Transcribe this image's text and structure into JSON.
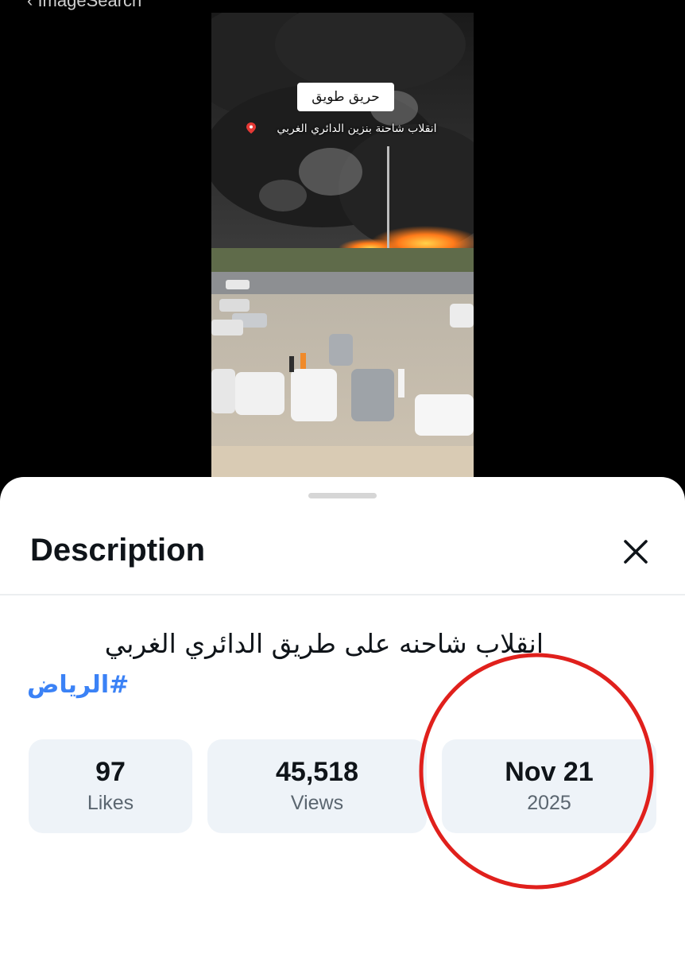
{
  "header": {
    "link_text": "‹ ImageSearch"
  },
  "video": {
    "caption_title": "حريق طويق",
    "caption_subtitle": "انقلاب شاحنة بنزين الدائري الغربي"
  },
  "sheet": {
    "title": "Description",
    "description": "انقلاب شاحنه على طريق الدائري الغربي",
    "hashtag": "#الرياض",
    "stats": [
      {
        "value": "97",
        "label": "Likes"
      },
      {
        "value": "45,518",
        "label": "Views"
      },
      {
        "value": "Nov 21",
        "label": "2025"
      }
    ]
  },
  "colors": {
    "hashtag": "#3b82f6",
    "highlight_circle": "#e0201c",
    "card_bg": "#eef3f8"
  },
  "icons": [
    "close-icon",
    "location-pin-icon"
  ]
}
